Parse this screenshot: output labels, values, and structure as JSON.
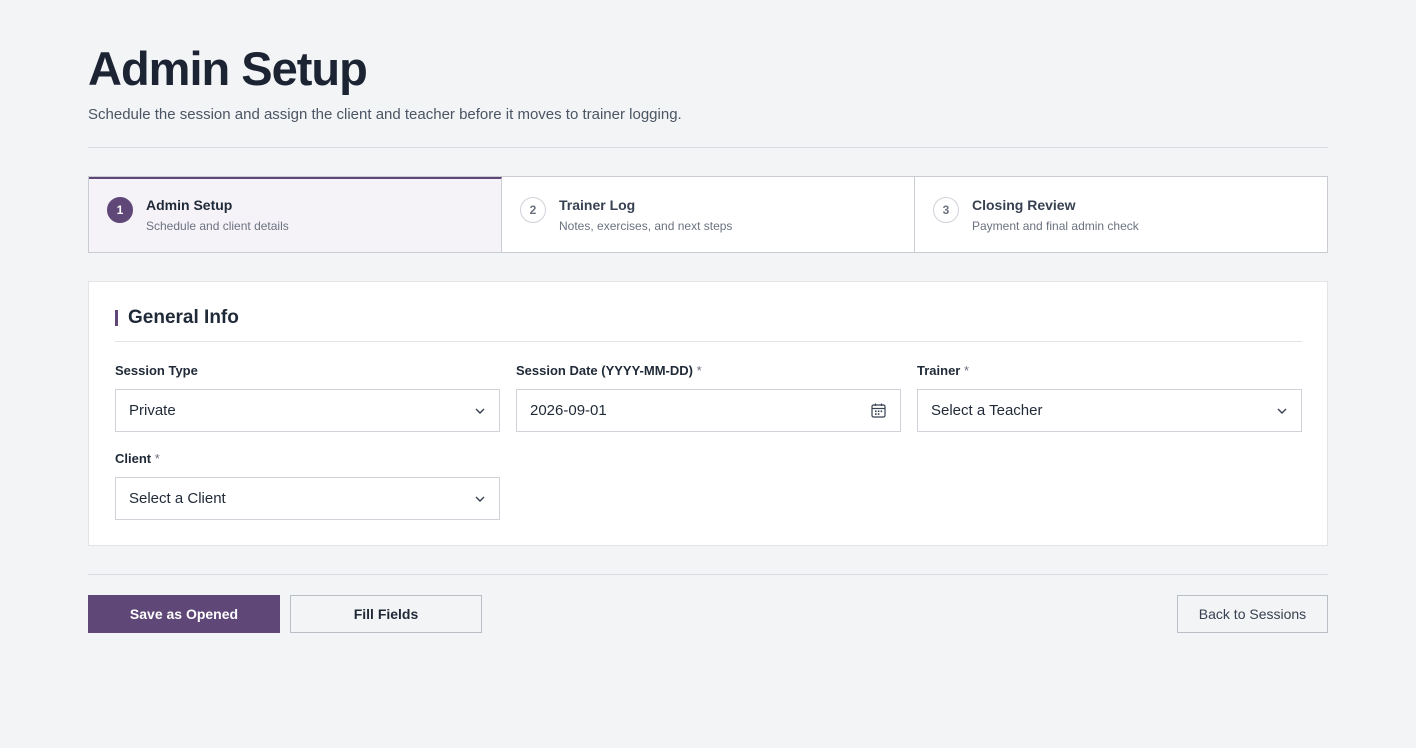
{
  "header": {
    "title": "Admin Setup",
    "subtitle": "Schedule the session and assign the client and teacher before it moves to trainer logging."
  },
  "steps": [
    {
      "number": "1",
      "title": "Admin Setup",
      "description": "Schedule and client details",
      "active": true
    },
    {
      "number": "2",
      "title": "Trainer Log",
      "description": "Notes, exercises, and next steps",
      "active": false
    },
    {
      "number": "3",
      "title": "Closing Review",
      "description": "Payment and final admin check",
      "active": false
    }
  ],
  "section": {
    "title": "General Info"
  },
  "fields": {
    "session_type": {
      "label": "Session Type",
      "value": "Private"
    },
    "session_date": {
      "label": "Session Date (YYYY-MM-DD)",
      "required_mark": "*",
      "value": "2026-09-01"
    },
    "trainer": {
      "label": "Trainer",
      "required_mark": "*",
      "value": "Select a Teacher"
    },
    "client": {
      "label": "Client",
      "required_mark": "*",
      "value": "Select a Client"
    }
  },
  "actions": {
    "save_label": "Save as Opened",
    "fill_label": "Fill Fields",
    "back_label": "Back to Sessions"
  },
  "colors": {
    "accent": "#5f4778",
    "background": "#f3f4f6"
  },
  "icons": {
    "dropdown": "chevron-down-icon",
    "date": "calendar-icon"
  }
}
